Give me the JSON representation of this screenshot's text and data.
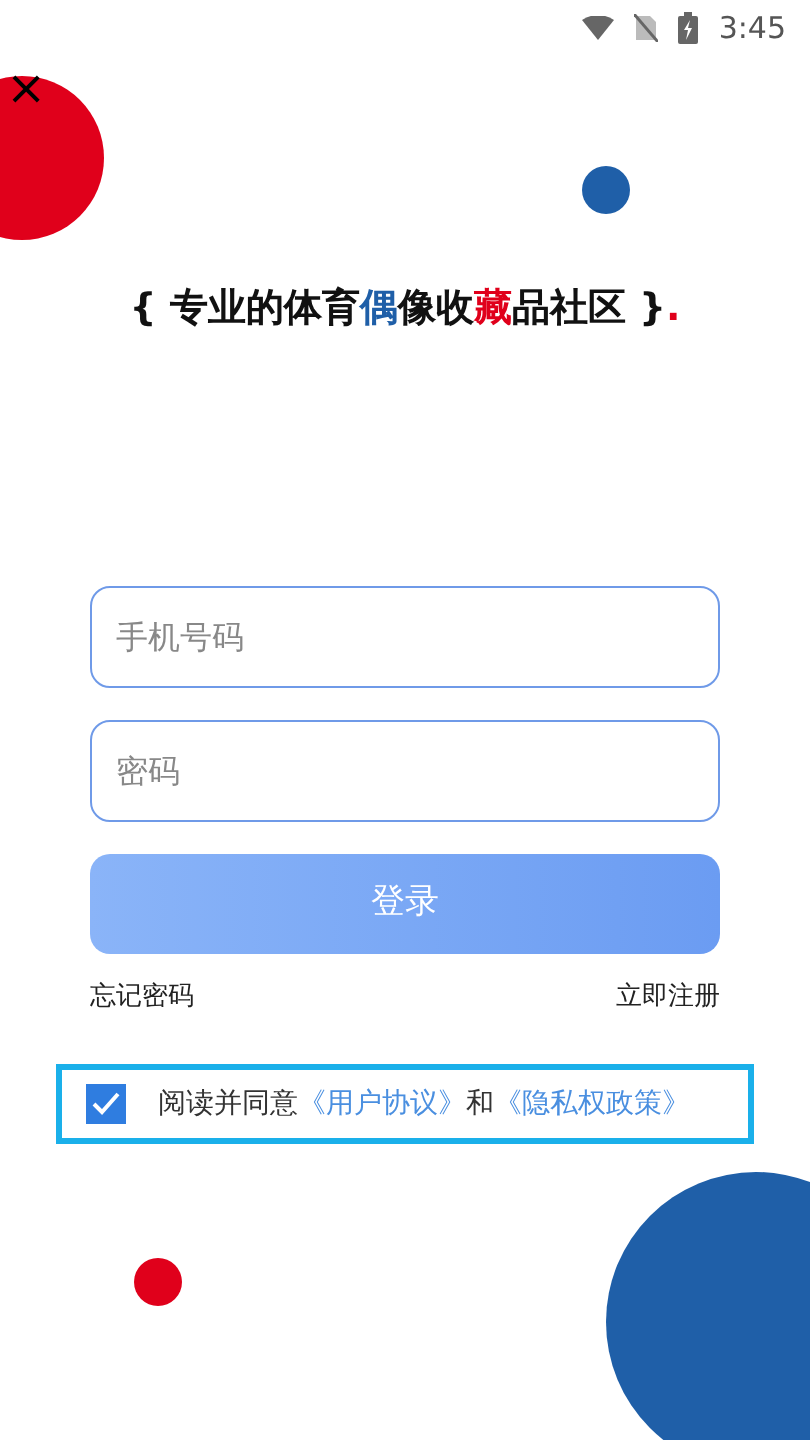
{
  "status_bar": {
    "time": "3:45"
  },
  "close_button": {
    "label": "×"
  },
  "slogan": [
    {
      "text": "{ 专业的体育",
      "color": "#111111"
    },
    {
      "text": "偶",
      "color": "#1f5fa8"
    },
    {
      "text": "像收",
      "color": "#111111"
    },
    {
      "text": "藏",
      "color": "#e0001b"
    },
    {
      "text": "品社区 }",
      "color": "#111111"
    },
    {
      "text": ".",
      "color": "#e0001b"
    }
  ],
  "phone_field": {
    "placeholder": "手机号码"
  },
  "password_field": {
    "placeholder": "密码"
  },
  "login_button": {
    "label": "登录"
  },
  "forgot_link": "忘记密码",
  "register_link": "立即注册",
  "agreement": {
    "checked": true,
    "text": "阅读并同意",
    "link_1": "《用户协议》",
    "joiner": "和",
    "link_2": "《隐私权政策》"
  }
}
